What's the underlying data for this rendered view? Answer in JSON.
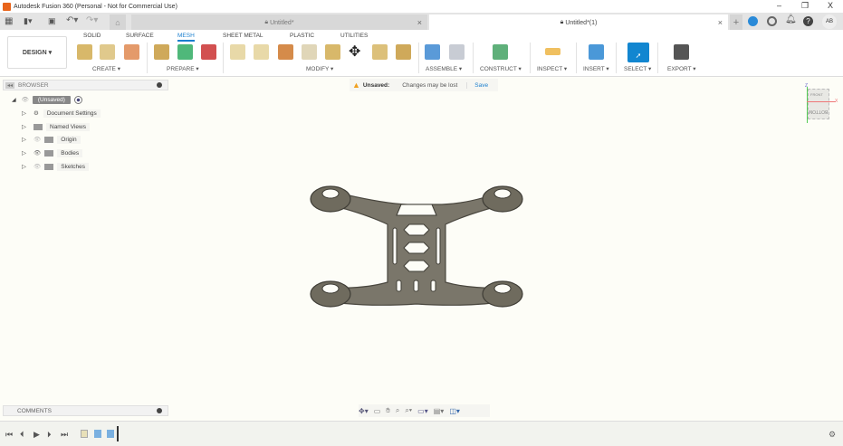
{
  "window": {
    "title": "Autodesk Fusion 360 (Personal - Not for Commercial Use)",
    "minimize": "–",
    "maximize": "❐",
    "close": "X"
  },
  "tabs": [
    {
      "label": "Untitled*"
    },
    {
      "label": "Untitled*(1)"
    }
  ],
  "user_initials": "AB",
  "workspace": "DESIGN ▾",
  "ribbon_tabs": [
    "SOLID",
    "SURFACE",
    "MESH",
    "SHEET METAL",
    "PLASTIC",
    "UTILITIES"
  ],
  "groups": [
    "CREATE ▾",
    "PREPARE ▾",
    "MODIFY ▾",
    "ASSEMBLE ▾",
    "CONSTRUCT ▾",
    "INSPECT ▾",
    "INSERT ▾",
    "SELECT ▾",
    "EXPORT ▾"
  ],
  "browser": {
    "title": "BROWSER",
    "root": "(Unsaved)",
    "items": [
      "Document Settings",
      "Named Views",
      "Origin",
      "Bodies",
      "Sketches"
    ]
  },
  "notice": {
    "label": "Unsaved:",
    "message": "Changes may be lost",
    "action": "Save"
  },
  "viewcube": {
    "top": "FRONT",
    "face": "BOTTOM",
    "x": "X",
    "z": "Z"
  },
  "comments": "COMMENTS",
  "colors": {
    "accent": "#1a7fcf",
    "model": "#6f6b5e",
    "warning": "#f0a020"
  }
}
